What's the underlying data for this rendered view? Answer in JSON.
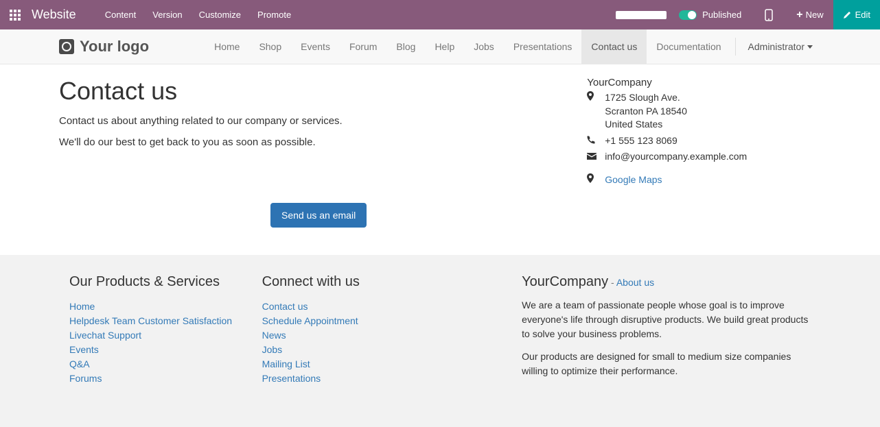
{
  "topbar": {
    "brand": "Website",
    "menu": [
      "Content",
      "Version",
      "Customize",
      "Promote"
    ],
    "published": "Published",
    "new": "New",
    "edit": "Edit"
  },
  "nav": {
    "logo": "Your logo",
    "items": [
      "Home",
      "Shop",
      "Events",
      "Forum",
      "Blog",
      "Help",
      "Jobs",
      "Presentations",
      "Contact us",
      "Documentation"
    ],
    "active": "Contact us",
    "admin": "Administrator"
  },
  "page": {
    "title": "Contact us",
    "lead1": "Contact us about anything related to our company or services.",
    "lead2": "We'll do our best to get back to you as soon as possible.",
    "button": "Send us an email"
  },
  "company": {
    "name": "YourCompany",
    "addr1": "1725 Slough Ave.",
    "addr2": "Scranton PA 18540",
    "addr3": "United States",
    "phone": "+1 555 123 8069",
    "email": "info@yourcompany.example.com",
    "maps": "Google Maps"
  },
  "footer": {
    "col1": {
      "title": "Our Products & Services",
      "links": [
        "Home",
        "Helpdesk Team Customer Satisfaction",
        "Livechat Support",
        "Events",
        "Q&A",
        "Forums"
      ]
    },
    "col2": {
      "title": "Connect with us",
      "links": [
        "Contact us",
        "Schedule Appointment",
        "News",
        "Jobs",
        "Mailing List",
        "Presentations"
      ]
    },
    "col3": {
      "title": "YourCompany",
      "sep": " - ",
      "about": "About us",
      "p1": "We are a team of passionate people whose goal is to improve everyone's life through disruptive products. We build great products to solve your business problems.",
      "p2": "Our products are designed for small to medium size companies willing to optimize their performance."
    }
  }
}
